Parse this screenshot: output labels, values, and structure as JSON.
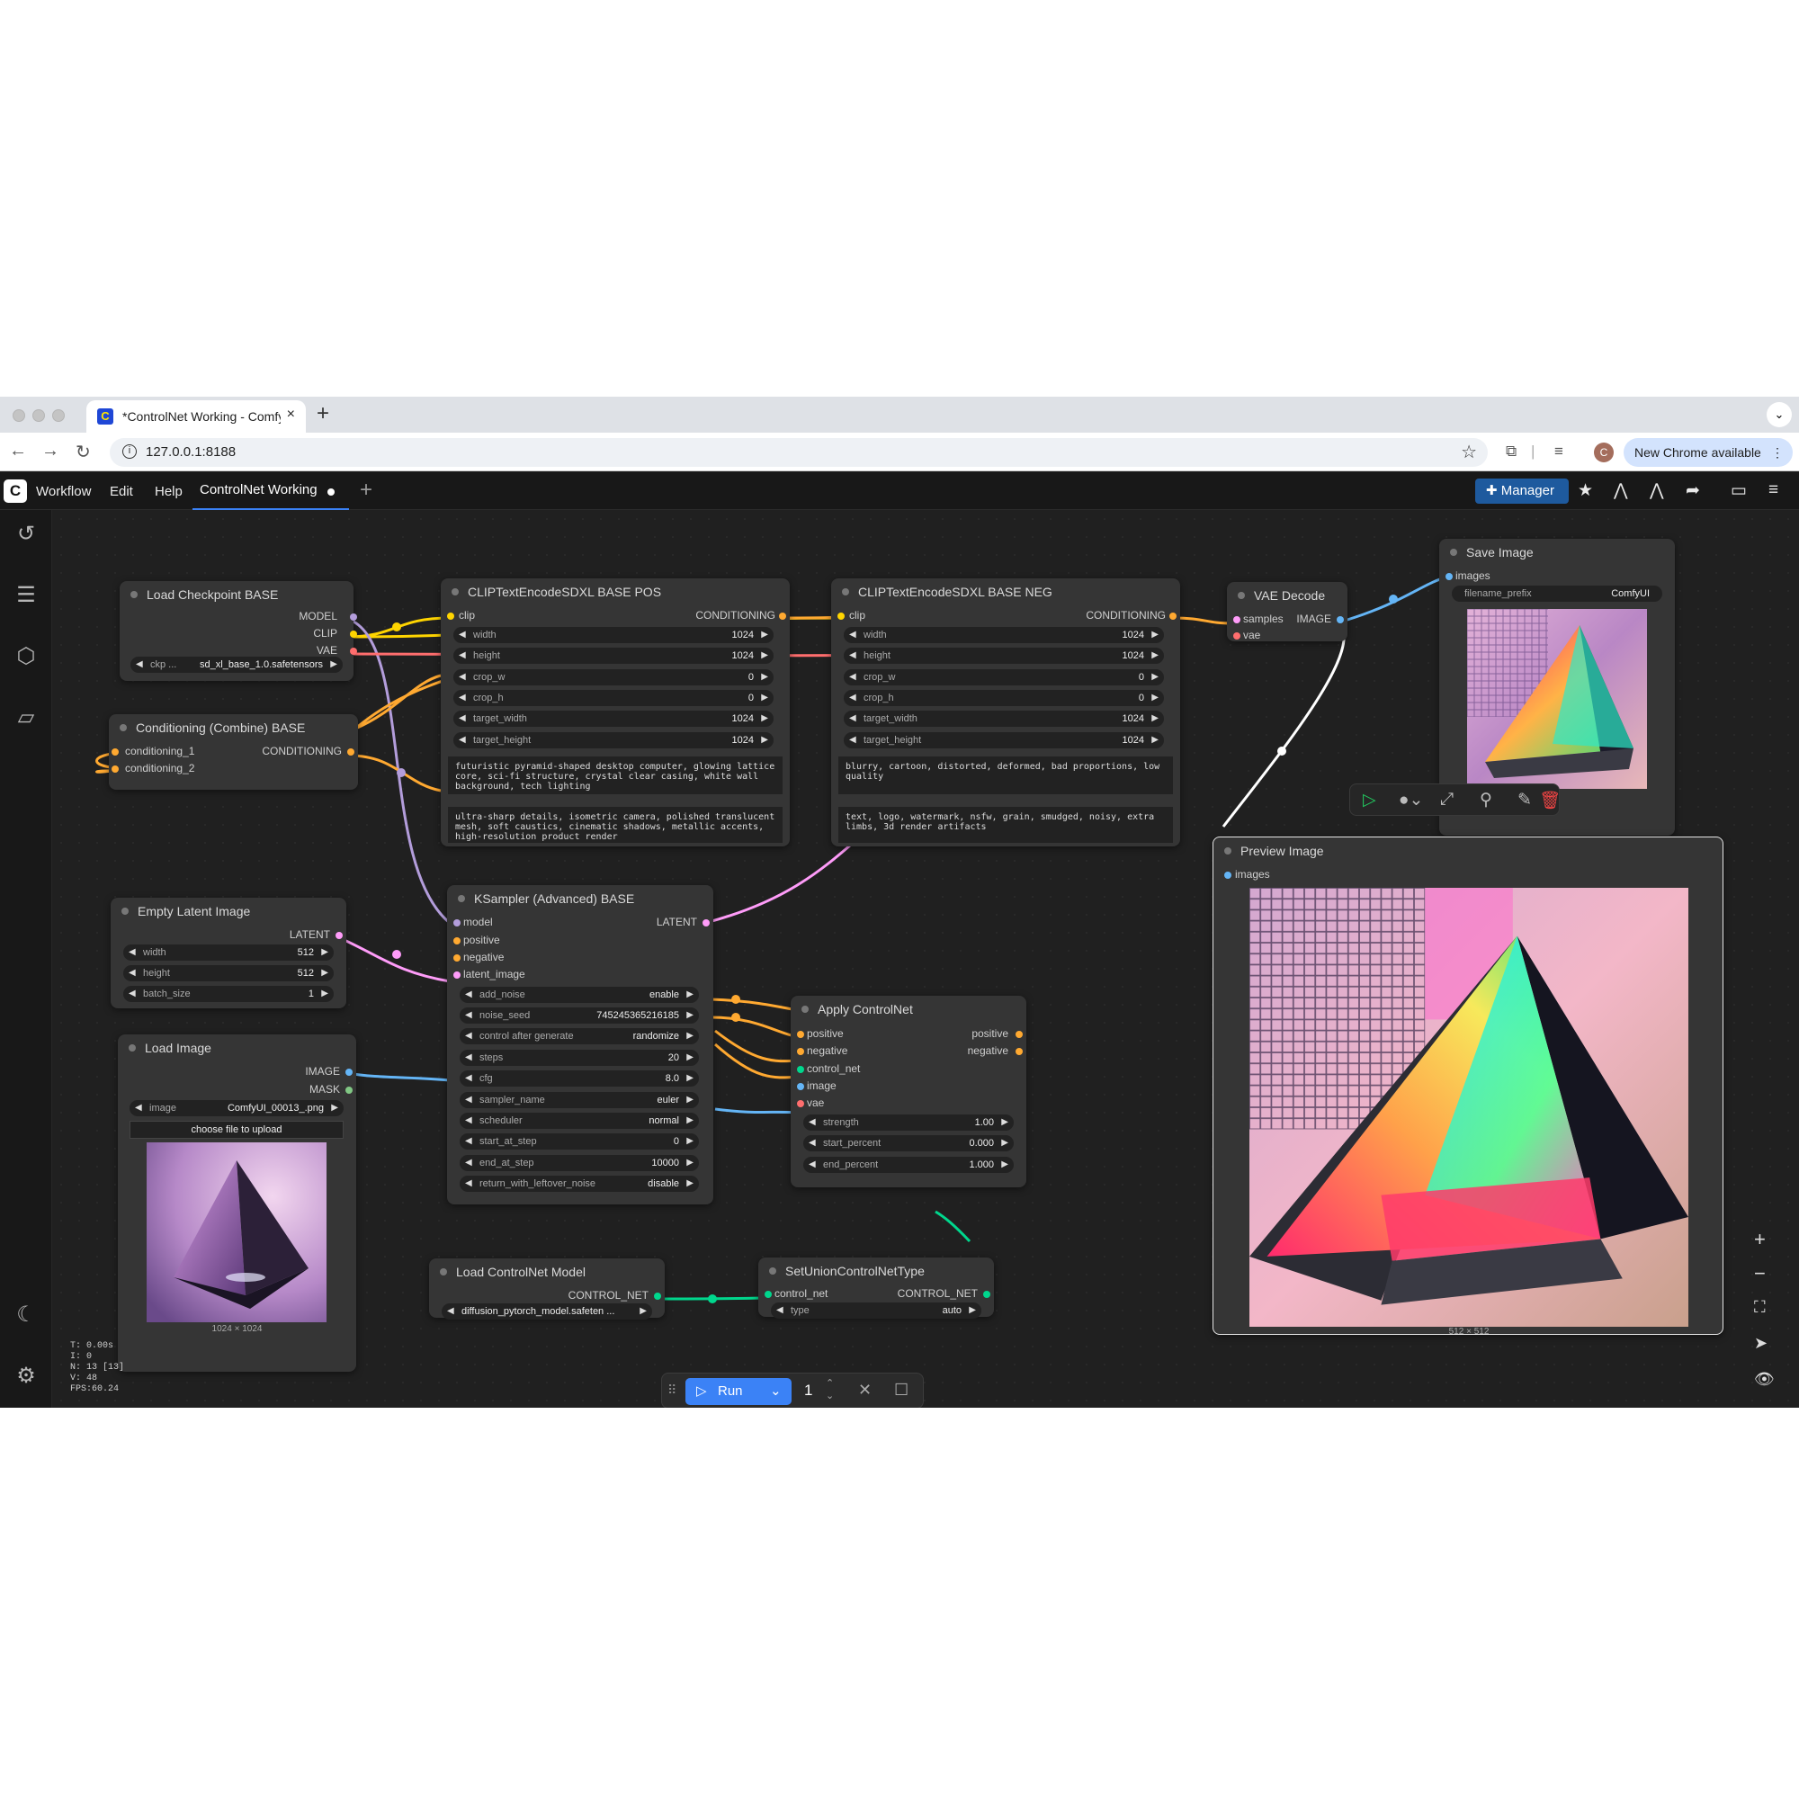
{
  "browser": {
    "tab_title": "*ControlNet Working - ComfyUI",
    "url": "127.0.0.1:8188",
    "new_chrome": "New Chrome available",
    "avatar_letter": "C"
  },
  "app": {
    "menus": [
      "Workflow",
      "Edit",
      "Help"
    ],
    "workflow_tab": "ControlNet Working",
    "manager_label": "Manager",
    "stats": [
      "T: 0.00s",
      "I: 0",
      "N: 13 [13]",
      "V: 48",
      "FPS:60.24"
    ]
  },
  "nodes": {
    "load_checkpoint": {
      "title": "Load Checkpoint BASE",
      "outputs": [
        "MODEL",
        "CLIP",
        "VAE"
      ],
      "ckpt_label": "ckp ...",
      "ckpt_value": "sd_xl_base_1.0.safetensors"
    },
    "cond_combine": {
      "title": "Conditioning (Combine) BASE",
      "inputs": [
        "conditioning_1",
        "conditioning_2"
      ],
      "output": "CONDITIONING"
    },
    "clip_pos": {
      "title": "CLIPTextEncodeSDXL BASE POS",
      "input": "clip",
      "output": "CONDITIONING",
      "widgets": [
        {
          "label": "width",
          "value": "1024"
        },
        {
          "label": "height",
          "value": "1024"
        },
        {
          "label": "crop_w",
          "value": "0"
        },
        {
          "label": "crop_h",
          "value": "0"
        },
        {
          "label": "target_width",
          "value": "1024"
        },
        {
          "label": "target_height",
          "value": "1024"
        }
      ],
      "text_g": "futuristic pyramid-shaped desktop computer, glowing lattice core, sci-fi structure, crystal clear casing, white wall background, tech lighting",
      "text_l": "ultra-sharp details, isometric camera, polished translucent mesh, soft caustics, cinematic shadows, metallic accents, high-resolution product render"
    },
    "clip_neg": {
      "title": "CLIPTextEncodeSDXL BASE NEG",
      "input": "clip",
      "output": "CONDITIONING",
      "widgets": [
        {
          "label": "width",
          "value": "1024"
        },
        {
          "label": "height",
          "value": "1024"
        },
        {
          "label": "crop_w",
          "value": "0"
        },
        {
          "label": "crop_h",
          "value": "0"
        },
        {
          "label": "target_width",
          "value": "1024"
        },
        {
          "label": "target_height",
          "value": "1024"
        }
      ],
      "text_g": "blurry, cartoon, distorted, deformed, bad proportions, low quality",
      "text_l": "text, logo, watermark, nsfw, grain, smudged, noisy, extra limbs, 3d render artifacts"
    },
    "vae_decode": {
      "title": "VAE Decode",
      "inputs": [
        "samples",
        "vae"
      ],
      "output": "IMAGE"
    },
    "save_image": {
      "title": "Save Image",
      "input": "images",
      "prefix_label": "filename_prefix",
      "prefix_value": "ComfyUI"
    },
    "preview_image": {
      "title": "Preview Image",
      "input": "images",
      "caption": "512 × 512"
    },
    "empty_latent": {
      "title": "Empty Latent Image",
      "output": "LATENT",
      "widgets": [
        {
          "label": "width",
          "value": "512"
        },
        {
          "label": "height",
          "value": "512"
        },
        {
          "label": "batch_size",
          "value": "1"
        }
      ]
    },
    "load_image": {
      "title": "Load Image",
      "outputs": [
        "IMAGE",
        "MASK"
      ],
      "image_label": "image",
      "image_value": "ComfyUI_00013_.png",
      "upload_label": "choose file to upload",
      "caption": "1024 × 1024"
    },
    "ksampler": {
      "title": "KSampler (Advanced) BASE",
      "inputs": [
        "model",
        "positive",
        "negative",
        "latent_image"
      ],
      "output": "LATENT",
      "widgets": [
        {
          "label": "add_noise",
          "value": "enable"
        },
        {
          "label": "noise_seed",
          "value": "745245365216185"
        },
        {
          "label": "control after generate",
          "value": "randomize"
        },
        {
          "label": "steps",
          "value": "20"
        },
        {
          "label": "cfg",
          "value": "8.0"
        },
        {
          "label": "sampler_name",
          "value": "euler"
        },
        {
          "label": "scheduler",
          "value": "normal"
        },
        {
          "label": "start_at_step",
          "value": "0"
        },
        {
          "label": "end_at_step",
          "value": "10000"
        },
        {
          "label": "return_with_leftover_noise",
          "value": "disable"
        }
      ]
    },
    "apply_controlnet": {
      "title": "Apply ControlNet",
      "inputs": [
        "positive",
        "negative",
        "control_net",
        "image",
        "vae"
      ],
      "outputs": [
        "positive",
        "negative"
      ],
      "widgets": [
        {
          "label": "strength",
          "value": "1.00"
        },
        {
          "label": "start_percent",
          "value": "0.000"
        },
        {
          "label": "end_percent",
          "value": "1.000"
        }
      ]
    },
    "load_controlnet": {
      "title": "Load ControlNet Model",
      "output": "CONTROL_NET",
      "value": "diffusion_pytorch_model.safeten ..."
    },
    "set_union": {
      "title": "SetUnionControlNetType",
      "input": "control_net",
      "output": "CONTROL_NET",
      "type_label": "type",
      "type_value": "auto"
    }
  },
  "run_bar": {
    "run_label": "Run",
    "batch_count": "1"
  },
  "colors": {
    "model": "#b39ddb",
    "clip": "#ffd500",
    "vae": "#ff6e6e",
    "conditioning": "#ffa931",
    "latent": "#ff9cf9",
    "image": "#64b5f6",
    "mask": "#81c784",
    "control_net": "#00d78d",
    "accent": "#3b82f6"
  }
}
